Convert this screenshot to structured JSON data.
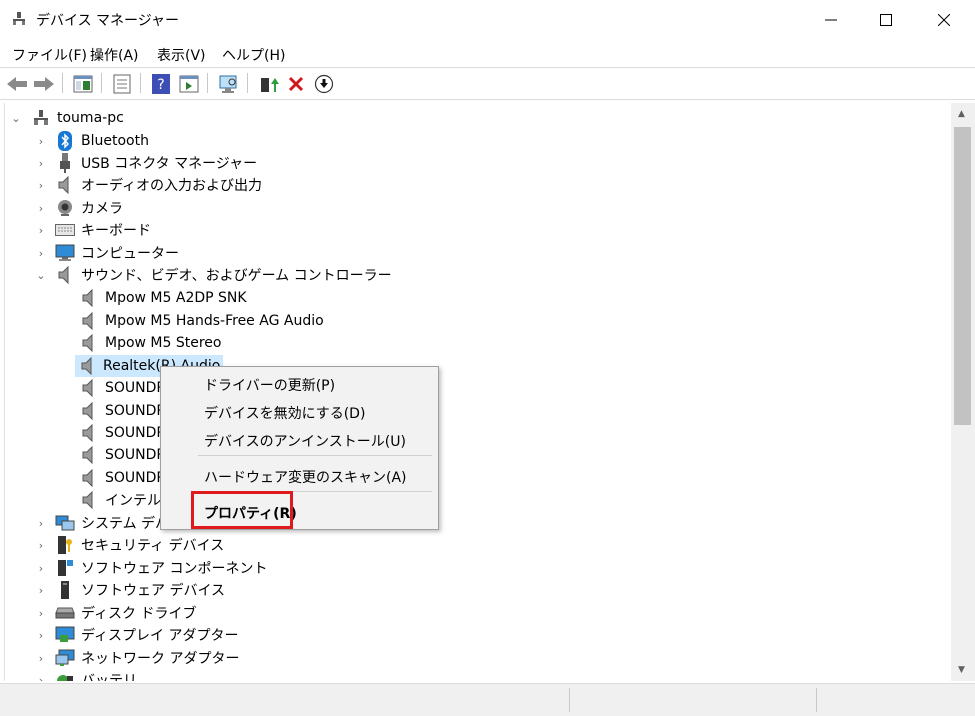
{
  "window": {
    "title": "デバイス マネージャー"
  },
  "menu": [
    "ファイル(F)",
    "操作(A)",
    "表示(V)",
    "ヘルプ(H)"
  ],
  "toolbar": {
    "icons": [
      "back-arrow-icon",
      "forward-arrow-icon",
      "show-hide-console-tree-icon",
      "properties-icon",
      "help-icon",
      "action-pane-icon",
      "scan-hardware-icon",
      "update-driver-icon",
      "uninstall-icon",
      "disable-device-icon"
    ]
  },
  "tree": {
    "root": "touma-pc",
    "categories": [
      "Bluetooth",
      "USB コネクタ マネージャー",
      "オーディオの入力および出力",
      "カメラ",
      "キーボード",
      "コンピューター",
      "サウンド、ビデオ、およびゲーム コントローラー"
    ],
    "sound_children": [
      "Mpow M5 A2DP SNK",
      "Mpow M5 Hands-Free AG Audio",
      "Mpow M5 Stereo",
      "Realtek(R) Audio",
      "SOUNDP",
      "SOUNDP",
      "SOUNDP",
      "SOUNDP",
      "SOUNDP",
      "インテル(R"
    ],
    "more_categories": [
      "システム デバイ",
      "セキュリティ デバイス",
      "ソフトウェア コンポーネント",
      "ソフトウェア デバイス",
      "ディスク ドライブ",
      "ディスプレイ アダプター",
      "ネットワーク アダプター",
      "バッテリ"
    ]
  },
  "context_menu": {
    "items": [
      "ドライバーの更新(P)",
      "デバイスを無効にする(D)",
      "デバイスのアンインストール(U)",
      "ハードウェア変更のスキャン(A)",
      "プロパティ(R)"
    ]
  },
  "colors": {
    "selection": "#cce8ff",
    "highlight_border": "#e0191e"
  }
}
